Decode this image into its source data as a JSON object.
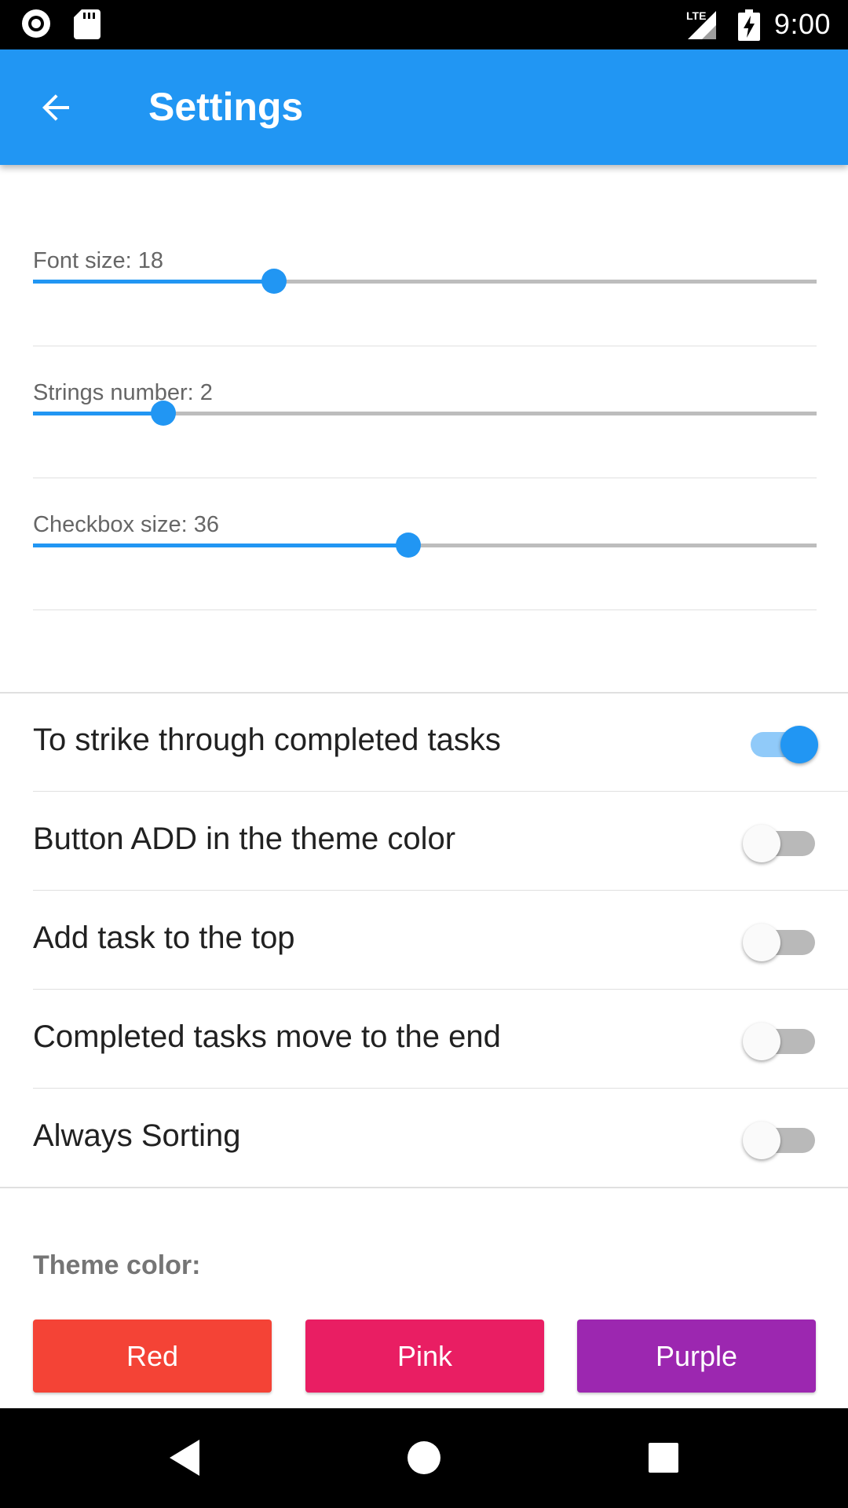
{
  "status_bar": {
    "time": "9:00",
    "network_label": "LTE",
    "icons": [
      "record-icon",
      "sd-card-icon",
      "lte-signal-icon",
      "battery-charging-icon"
    ]
  },
  "app_bar": {
    "title": "Settings",
    "back_icon": "arrow-back-icon"
  },
  "sliders": [
    {
      "label": "Font size:  18",
      "fraction": 0.308
    },
    {
      "label": "Strings number:  2",
      "fraction": 0.166
    },
    {
      "label": "Checkbox size:  36",
      "fraction": 0.479
    }
  ],
  "switches": [
    {
      "label": "To strike through completed tasks",
      "on": true
    },
    {
      "label": "Button ADD in the theme color",
      "on": false
    },
    {
      "label": "Add task to the top",
      "on": false
    },
    {
      "label": "Completed tasks move to the end",
      "on": false
    },
    {
      "label": "Always Sorting",
      "on": false
    }
  ],
  "theme": {
    "label": "Theme color:",
    "buttons": [
      {
        "label": "Red",
        "color": "#f44336"
      },
      {
        "label": "Pink",
        "color": "#e91e63"
      },
      {
        "label": "Purple",
        "color": "#9c27b0"
      }
    ]
  },
  "colors": {
    "accent": "#2196f3",
    "accent_light": "#90caf9"
  },
  "nav_bar": {
    "icons": [
      "back-triangle-icon",
      "home-circle-icon",
      "recents-square-icon"
    ]
  }
}
